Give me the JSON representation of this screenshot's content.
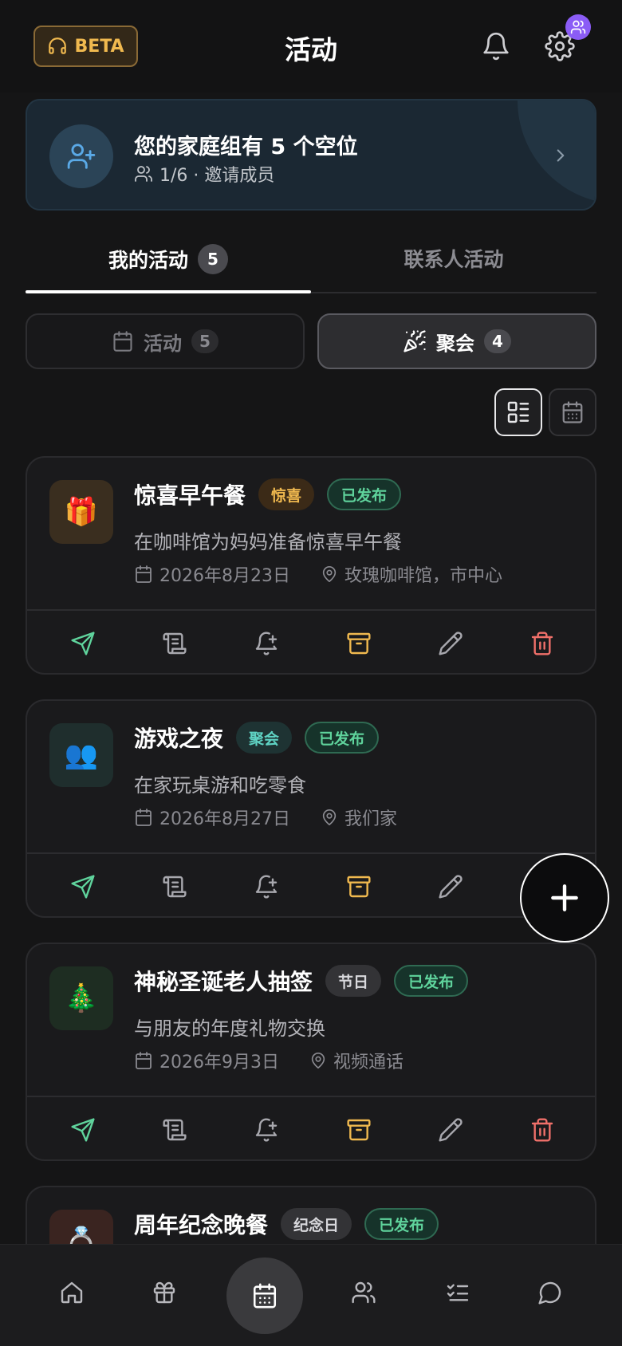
{
  "header": {
    "beta_label": "BETA",
    "title": "活动",
    "notification_count": ""
  },
  "family_banner": {
    "title": "您的家庭组有 5 个空位",
    "subtitle": "1/6 · 邀请成员"
  },
  "tabs": [
    {
      "label": "我的活动",
      "count": "5",
      "active": true
    },
    {
      "label": "联系人活动",
      "active": false
    }
  ],
  "segments": [
    {
      "label": "活动",
      "count": "5",
      "active": false
    },
    {
      "label": "聚会",
      "count": "4",
      "active": true
    }
  ],
  "events": [
    {
      "icon": "🎁",
      "icon_bg": "#3a2e1f",
      "name": "惊喜早午餐",
      "tag": "惊喜",
      "tag_bg": "#3b2a17",
      "tag_color": "#f0b94f",
      "status": "已发布",
      "description": "在咖啡馆为妈妈准备惊喜早午餐",
      "date": "2026年8月23日",
      "location": "玫瑰咖啡馆，市中心"
    },
    {
      "icon": "👥",
      "icon_bg": "#1f2e2d",
      "name": "游戏之夜",
      "tag": "聚会",
      "tag_bg": "#1e3333",
      "tag_color": "#5fd3c4",
      "status": "已发布",
      "description": "在家玩桌游和吃零食",
      "date": "2026年8月27日",
      "location": "我们家"
    },
    {
      "icon": "🎄",
      "icon_bg": "#1e2d22",
      "name": "神秘圣诞老人抽签",
      "tag": "节日",
      "tag_bg": "#333336",
      "tag_color": "#d8d8dc",
      "status": "已发布",
      "description": "与朋友的年度礼物交换",
      "date": "2026年9月3日",
      "location": "视频通话"
    },
    {
      "icon": "💍",
      "icon_bg": "#3a2420",
      "name": "周年纪念晚餐",
      "tag": "纪念日",
      "tag_bg": "#333336",
      "tag_color": "#d8d8dc",
      "status": "已发布",
      "description": "",
      "date": "",
      "location": ""
    }
  ],
  "colors": {
    "send": "#5fd39c",
    "archive": "#f0b94f",
    "delete": "#f0706a",
    "neutral": "#a8a8ae"
  }
}
